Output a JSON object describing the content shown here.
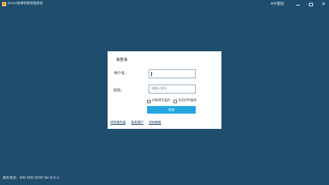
{
  "window": {
    "title": "Smart影楼智能管理系统",
    "user_link": "A中登陆",
    "controls": {
      "minimize": "—",
      "close": "✕"
    }
  },
  "login": {
    "title": "请登录",
    "username_label": "用户名：",
    "username_value": "",
    "password_label": "密码：",
    "password_placeholder": "请输入密码",
    "options": [
      {
        "label": "开机用于品片"
      },
      {
        "label": "开启打印服务"
      }
    ],
    "submit_label": "登录",
    "links": [
      "修改服务器",
      "联系我们",
      "初始数据"
    ]
  },
  "status": {
    "service_line": "服务电话：400-000-3030  Ver:6.5.1"
  }
}
